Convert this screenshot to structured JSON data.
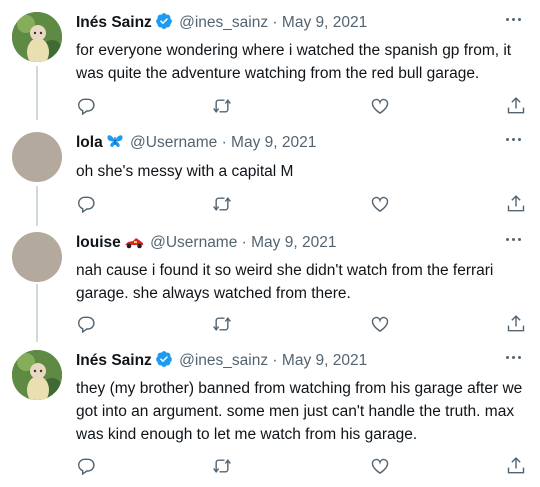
{
  "tweets": [
    {
      "name": "Inés Sainz",
      "verified": true,
      "handle": "@ines_sainz",
      "separator": "·",
      "date": "May 9, 2021",
      "text": "for everyone wondering where i watched the spanish gp from, it was quite the adventure watching from the red bull garage."
    },
    {
      "name": "lola",
      "name_emoji": "butterfly-emoji",
      "handle": "@Username",
      "separator": "·",
      "date": "May 9, 2021",
      "text": "oh she's messy with a capital M"
    },
    {
      "name": "louise",
      "name_emoji": "racing-car-emoji",
      "handle": "@Username",
      "separator": "·",
      "date": "May 9, 2021",
      "text": "nah cause i found it so weird she didn't watch from the ferrari garage. she always watched from there."
    },
    {
      "name": "Inés Sainz",
      "verified": true,
      "handle": "@ines_sainz",
      "separator": "·",
      "date": "May 9, 2021",
      "text": "they (my brother) banned from watching from his garage after we got into an argument. some men just can't handle the truth. max was kind enough to let me watch from his garage."
    }
  ],
  "colors": {
    "verified": "#1d9bf0",
    "muted": "#536471",
    "connector": "#cfd9de",
    "butterfly": "#1d9bf0",
    "racing_car": "#d22630"
  },
  "icons": [
    "reply-icon",
    "retweet-icon",
    "like-icon",
    "share-icon",
    "more-icon",
    "verified-badge-icon"
  ]
}
